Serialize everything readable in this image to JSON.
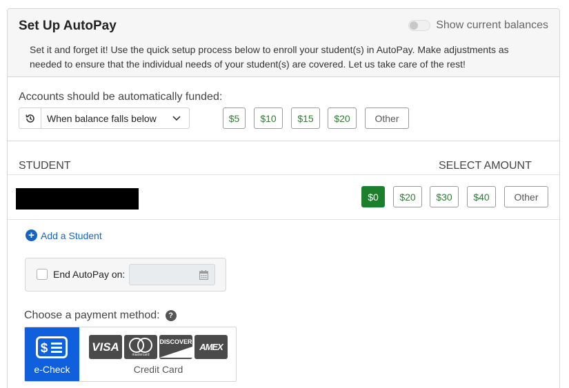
{
  "header": {
    "title": "Set Up AutoPay",
    "toggle_label": "Show current balances",
    "description": "Set it and forget it! Use the quick setup process below to enroll your student(s) in AutoPay. Make adjustments as needed to ensure that the individual needs of your student(s) are covered. Let us take care of the rest!"
  },
  "funding": {
    "label": "Accounts should be automatically funded:",
    "select_value": "When balance falls below",
    "amounts": [
      "$5",
      "$10",
      "$15",
      "$20"
    ],
    "other_label": "Other"
  },
  "table": {
    "student_header": "STUDENT",
    "amount_header": "SELECT AMOUNT"
  },
  "student_row": {
    "amounts": [
      "$0",
      "$20",
      "$30",
      "$40"
    ],
    "selected": "$0",
    "other_label": "Other"
  },
  "add_student_label": "Add a Student",
  "end_autopay": {
    "label": "End AutoPay on:",
    "checked": false
  },
  "payment": {
    "label": "Choose a payment method:",
    "help_glyph": "?",
    "echeck_label": "e-Check",
    "card_brands": [
      "VISA",
      "mastercard",
      "DISCOVER",
      "AMEX"
    ],
    "credit_card_label": "Credit Card"
  },
  "colors": {
    "accent_green": "#1b7f2b",
    "link_blue": "#1565c0",
    "echeck_blue": "#1060dd"
  }
}
